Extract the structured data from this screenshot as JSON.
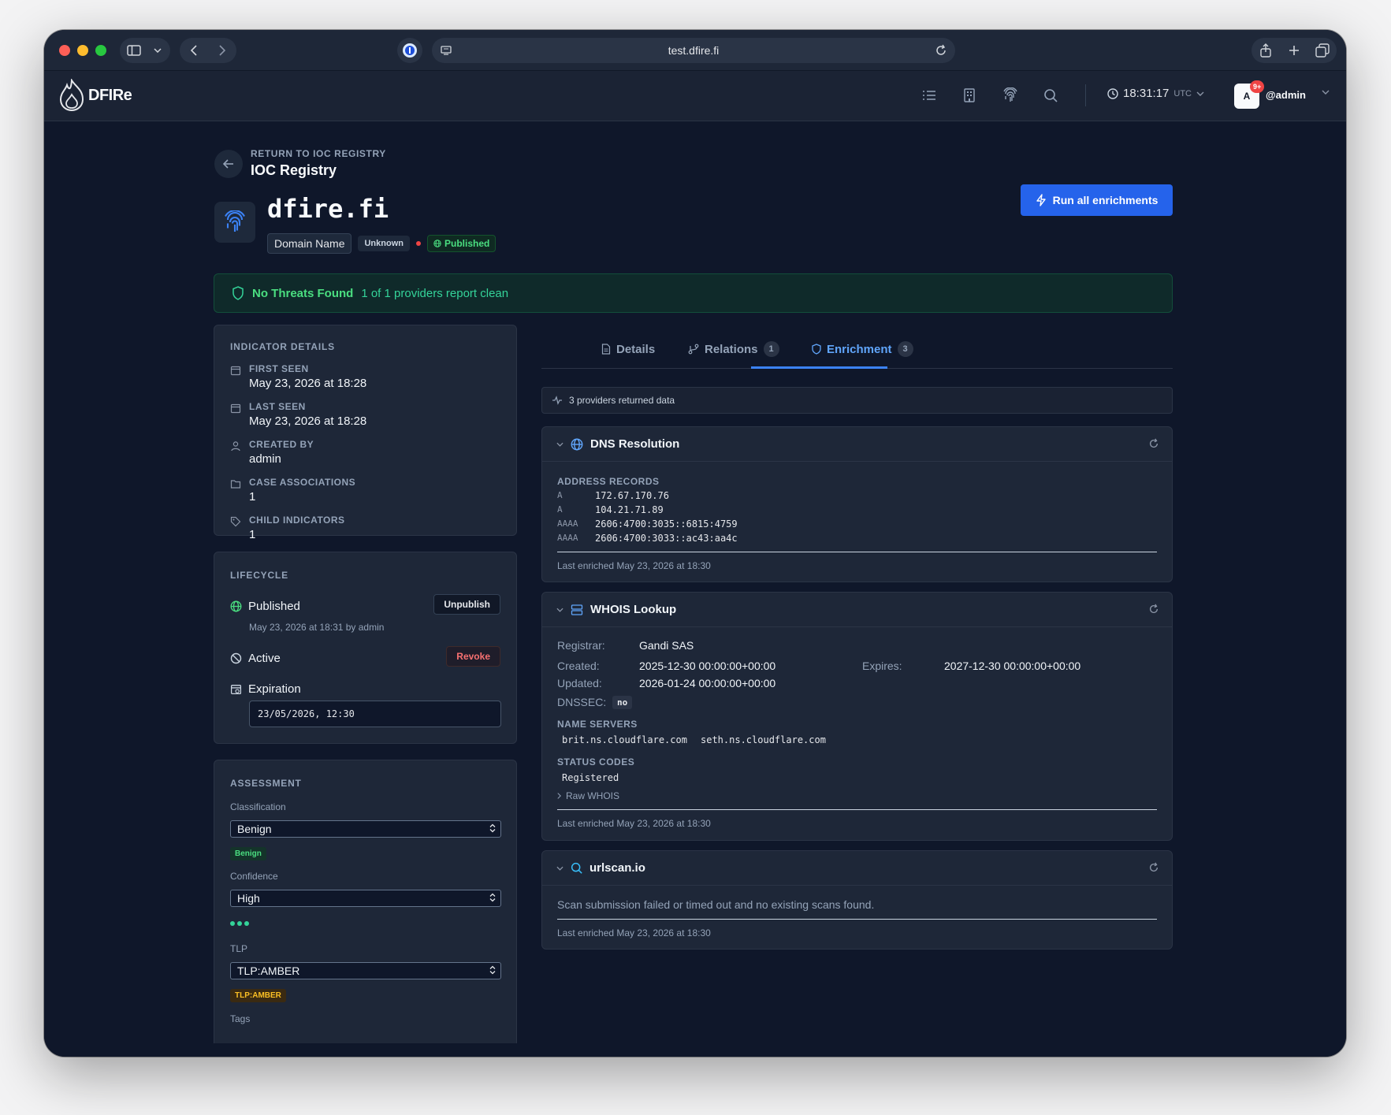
{
  "browser": {
    "url": "test.dfire.fi"
  },
  "header": {
    "app_name": "DFIRe",
    "time": "18:31:17",
    "tz": "UTC",
    "notif_count": "9+",
    "avatar_initial": "A",
    "username": "@admin"
  },
  "breadcrumb": {
    "return_label": "RETURN TO IOC REGISTRY",
    "title": "IOC Registry"
  },
  "ioc": {
    "value": "dfire.fi",
    "type": "Domain Name",
    "severity": "Unknown",
    "status": "Published"
  },
  "actions": {
    "run_all": "Run all enrichments"
  },
  "threat_banner": {
    "title": "No Threats Found",
    "subtitle": "1 of 1 providers report clean"
  },
  "indicator_details": {
    "title": "INDICATOR DETAILS",
    "items": [
      {
        "label": "FIRST SEEN",
        "value": "May 23, 2026 at 18:28"
      },
      {
        "label": "LAST SEEN",
        "value": "May 23, 2026 at 18:28"
      },
      {
        "label": "CREATED BY",
        "value": "admin"
      },
      {
        "label": "CASE ASSOCIATIONS",
        "value": "1"
      },
      {
        "label": "CHILD INDICATORS",
        "value": "1"
      }
    ]
  },
  "lifecycle": {
    "title": "LIFECYCLE",
    "published_label": "Published",
    "published_meta": "May 23, 2026 at 18:31 by admin",
    "unpublish_label": "Unpublish",
    "active_label": "Active",
    "revoke_label": "Revoke",
    "expiration_label": "Expiration",
    "expiration_value": "23/05/2026, 12:30"
  },
  "assessment": {
    "title": "ASSESSMENT",
    "classification_label": "Classification",
    "classification_value": "Benign",
    "classification_pill": "Benign",
    "confidence_label": "Confidence",
    "confidence_value": "High",
    "tlp_label": "TLP",
    "tlp_value": "TLP:AMBER",
    "tlp_pill": "TLP:AMBER",
    "tags_label": "Tags"
  },
  "tabs": [
    {
      "label": "Details",
      "count": ""
    },
    {
      "label": "Relations",
      "count": "1"
    },
    {
      "label": "Enrichment",
      "count": "3"
    }
  ],
  "enrichment": {
    "providers_summary": "3 providers returned data",
    "dns": {
      "title": "DNS Resolution",
      "section": "ADDRESS RECORDS",
      "records": [
        {
          "type": "A",
          "value": "172.67.170.76"
        },
        {
          "type": "A",
          "value": "104.21.71.89"
        },
        {
          "type": "AAAA",
          "value": "2606:4700:3035::6815:4759"
        },
        {
          "type": "AAAA",
          "value": "2606:4700:3033::ac43:aa4c"
        }
      ],
      "last_enriched": "Last enriched May 23, 2026 at 18:30"
    },
    "whois": {
      "title": "WHOIS Lookup",
      "registrar_label": "Registrar:",
      "registrar_value": "Gandi SAS",
      "created_label": "Created:",
      "created_value": "2025-12-30 00:00:00+00:00",
      "expires_label": "Expires:",
      "expires_value": "2027-12-30 00:00:00+00:00",
      "updated_label": "Updated:",
      "updated_value": "2026-01-24 00:00:00+00:00",
      "dnssec_label": "DNSSEC:",
      "dnssec_value": "no",
      "ns_section": "NAME SERVERS",
      "name_servers": [
        "brit.ns.cloudflare.com",
        "seth.ns.cloudflare.com"
      ],
      "status_section": "STATUS CODES",
      "status_codes": [
        "Registered"
      ],
      "raw_label": "Raw WHOIS",
      "last_enriched": "Last enriched May 23, 2026 at 18:30"
    },
    "urlscan": {
      "title": "urlscan.io",
      "message": "Scan submission failed or timed out and no existing scans found.",
      "last_enriched": "Last enriched May 23, 2026 at 18:30"
    }
  },
  "colors": {
    "accent": "#2563eb",
    "success": "#4ade80",
    "danger": "#ef4444",
    "amber": "#fbbf24",
    "background": "#0f172a",
    "card": "#1e2738"
  }
}
